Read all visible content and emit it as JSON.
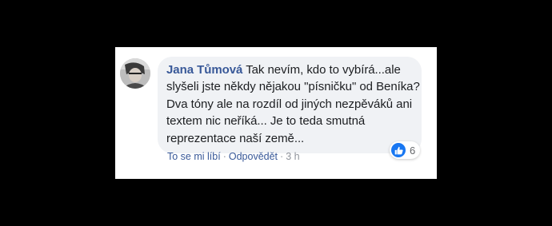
{
  "comment": {
    "author": "Jana Tůmová",
    "text": "Tak nevím, kdo to vybírá...ale slyšeli jste někdy nějakou \"písničku\" od Beníka? Dva tóny ale na rozdíl od jiných nezpěváků ani textem nic neříká... Je to teda smutná reprezentace naší země...",
    "reaction_count": "6",
    "reaction_icon": "like-icon",
    "avatar_icon": "profile-photo"
  },
  "actions": {
    "like_label": "To se mi líbí",
    "separator": "·",
    "reply_label": "Odpovědět",
    "timestamp": "3 h"
  },
  "colors": {
    "author_link": "#385898",
    "bubble": "#f0f2f5",
    "like_blue": "#1877f2",
    "meta_gray": "#90949c"
  }
}
